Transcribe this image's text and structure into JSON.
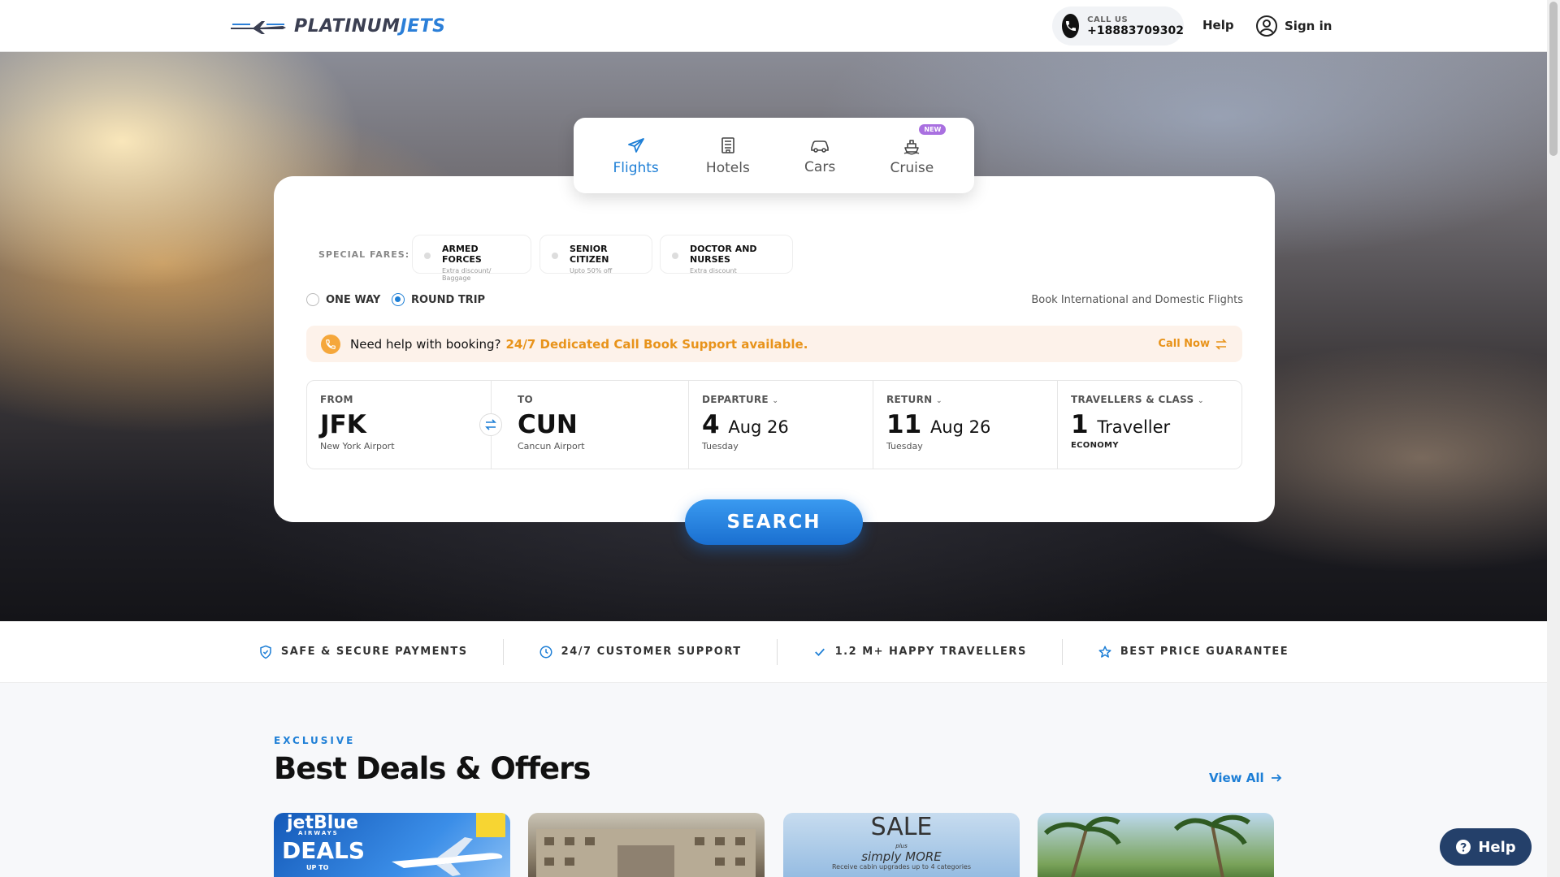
{
  "header": {
    "brand_a": "PLATINUM",
    "brand_b": "JETS",
    "call_label": "CALL US",
    "call_number": "+18883709302",
    "help": "Help",
    "signin": "Sign in"
  },
  "tabs": [
    {
      "label": "Flights",
      "icon": "plane-icon",
      "active": true
    },
    {
      "label": "Hotels",
      "icon": "building-icon"
    },
    {
      "label": "Cars",
      "icon": "car-icon"
    },
    {
      "label": "Cruise",
      "icon": "ship-icon",
      "badge": "NEW"
    }
  ],
  "special_fares": {
    "label": "SPECIAL FARES:",
    "items": [
      {
        "title": "ARMED FORCES",
        "sub": "Extra discount/ Baggage"
      },
      {
        "title": "SENIOR CITIZEN",
        "sub": "Upto 50% off"
      },
      {
        "title": "DOCTOR AND NURSES",
        "sub": "Extra discount"
      }
    ]
  },
  "trip_type": {
    "one_way": "ONE WAY",
    "round_trip": "ROUND TRIP",
    "selected": "ROUND TRIP"
  },
  "book_intl": "Book International and Domestic Flights",
  "help_bar": {
    "question": "Need help with booking?",
    "availability": "24/7 Dedicated Call Book Support available.",
    "call_now": "Call Now"
  },
  "search_fields": {
    "from": {
      "label": "FROM",
      "code": "JFK",
      "airport": "New York Airport"
    },
    "to": {
      "label": "TO",
      "code": "CUN",
      "airport": "Cancun Airport"
    },
    "departure": {
      "label": "DEPARTURE",
      "day": "4",
      "month": "Aug 26",
      "weekday": "Tuesday"
    },
    "return": {
      "label": "RETURN",
      "day": "11",
      "month": "Aug 26",
      "weekday": "Tuesday"
    },
    "travellers": {
      "label": "TRAVELLERS & CLASS",
      "count": "1",
      "unit": "Traveller",
      "class": "ECONOMY"
    }
  },
  "search_button": "SEARCH",
  "features": [
    {
      "label": "SAFE & SECURE PAYMENTS",
      "icon": "shield-icon"
    },
    {
      "label": "24/7 CUSTOMER SUPPORT",
      "icon": "clock-icon"
    },
    {
      "label": "1.2 M+ HAPPY TRAVELLERS",
      "icon": "check-icon"
    },
    {
      "label": "BEST PRICE GUARANTEE",
      "icon": "star-icon"
    }
  ],
  "deals": {
    "eyebrow": "EXCLUSIVE",
    "title": "Best Deals & Offers",
    "view_all": "View All",
    "cards": [
      {
        "brand": "jetBlue",
        "brand_sub": "AIRWAYS",
        "headline": "DEALS",
        "up_to": "UP TO"
      },
      {
        "alt": "hotel"
      },
      {
        "line1": "SALE",
        "plus": "plus",
        "line2": "simply MORE",
        "line3": "Receive cabin upgrades up to 4 categories"
      },
      {
        "alt": "beach"
      }
    ]
  },
  "help_widget": "Help",
  "colors": {
    "accent": "#1e7fd6",
    "orange": "#e8931a",
    "help_widget": "#24406a"
  }
}
